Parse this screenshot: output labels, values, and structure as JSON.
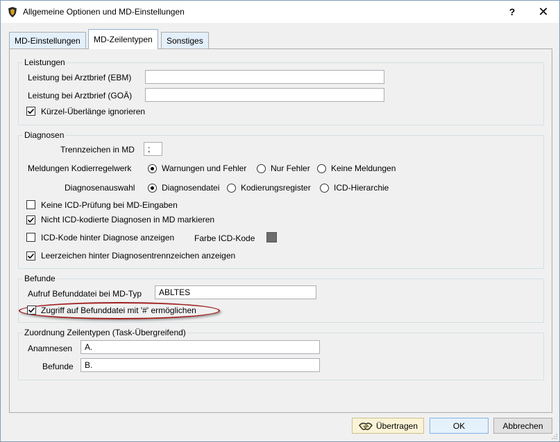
{
  "window": {
    "title": "Allgemeine Optionen und MD-Einstellungen",
    "help": "?",
    "close": "✕"
  },
  "tabs": [
    {
      "label": "MD-Einstellungen",
      "active": false
    },
    {
      "label": "MD-Zeilentypen",
      "active": true
    },
    {
      "label": "Sonstiges",
      "active": false
    }
  ],
  "leistungen": {
    "title": "Leistungen",
    "ebm_label": "Leistung bei Arztbrief (EBM)",
    "ebm_value": "",
    "goae_label": "Leistung bei Arztbrief (GOÄ)",
    "goae_value": "",
    "ignore_label": "Kürzel-Überlänge ignorieren",
    "ignore_checked": true
  },
  "diagnosen": {
    "title": "Diagnosen",
    "separator_label": "Trennzeichen in MD",
    "separator_value": ";",
    "messages_label": "Meldungen Kodierregelwerk",
    "messages_options": [
      "Warnungen und Fehler",
      "Nur Fehler",
      "Keine Meldungen"
    ],
    "messages_selected": 0,
    "selection_label": "Diagnosenauswahl",
    "selection_options": [
      "Diagnosendatei",
      "Kodierungsregister",
      "ICD-Hierarchie"
    ],
    "selection_selected": 0,
    "no_icd_check_label": "Keine ICD-Prüfung bei MD-Eingaben",
    "no_icd_check": false,
    "mark_uncoded_label": "Nicht ICD-kodierte Diagnosen in MD markieren",
    "mark_uncoded": true,
    "show_icd_label": "ICD-Kode hinter Diagnose anzeigen",
    "show_icd": false,
    "color_label": "Farbe ICD-Kode",
    "color_value": "#6c6c6c",
    "space_label": "Leerzeichen hinter Diagnosentrennzeichen anzeigen",
    "space": true
  },
  "befunde": {
    "title": "Befunde",
    "file_label": "Aufruf Befunddatei bei MD-Typ",
    "file_value": "ABLTES",
    "hash_label": "Zugriff auf Befunddatei mit '#' ermöglichen",
    "hash_checked": true
  },
  "zuordnung": {
    "title": "Zuordnung Zeilentypen (Task-Übergreifend)",
    "anamnesen_label": "Anamnesen",
    "anamnesen_value": "A.",
    "befunde_label": "Befunde",
    "befunde_value": "B."
  },
  "buttons": {
    "transfer": "Übertragen",
    "ok": "OK",
    "cancel": "Abbrechen"
  },
  "colors": {
    "highlight": "#a02020",
    "tab_active": "#ffffff",
    "tab_inactive": "#e3effa"
  }
}
